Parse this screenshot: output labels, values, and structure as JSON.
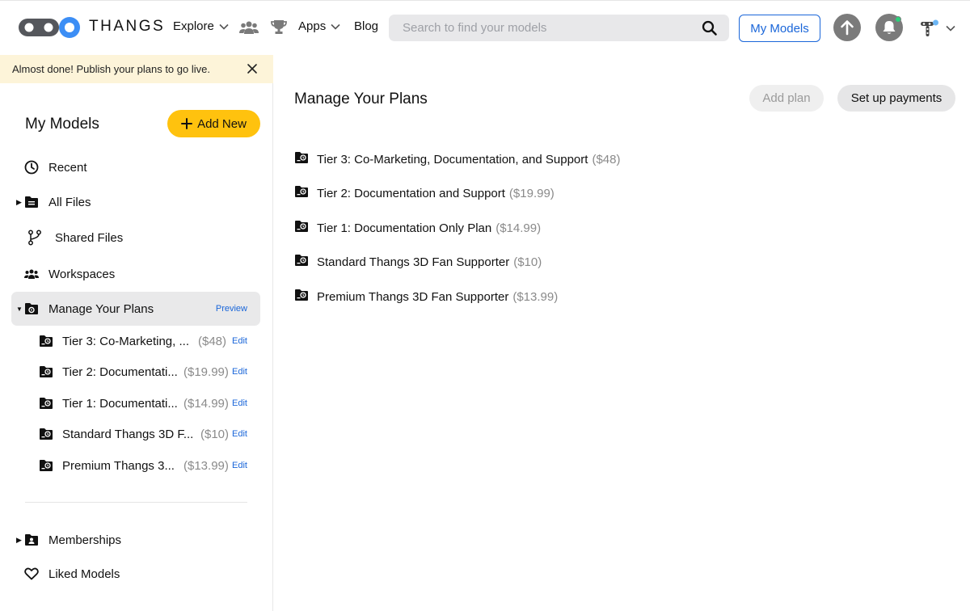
{
  "header": {
    "brand": "THANGS",
    "nav": [
      {
        "label": "Explore",
        "chevron": true
      },
      {
        "label": "Apps",
        "chevron": true
      },
      {
        "label": "Blog",
        "chevron": false
      }
    ],
    "search_placeholder": "Search to find your models",
    "my_models_label": "My Models"
  },
  "banner": {
    "text": "Almost done! Publish your plans to go live."
  },
  "sidebar": {
    "title": "My Models",
    "add_new_label": "Add New",
    "items": [
      {
        "label": "Recent",
        "icon": "clock-icon"
      },
      {
        "label": "All Files",
        "icon": "folder-icon"
      },
      {
        "label": "Shared Files",
        "icon": "branch-icon"
      },
      {
        "label": "Workspaces",
        "icon": "people-icon"
      },
      {
        "label": "Manage Your Plans",
        "icon": "folder-gear-icon",
        "badge": "Preview"
      }
    ],
    "plans": [
      {
        "name": "Tier 3: Co-Marketing, ...",
        "price": "($48)",
        "edit": "Edit"
      },
      {
        "name": "Tier 2: Documentati...",
        "price": "($19.99)",
        "edit": "Edit"
      },
      {
        "name": "Tier 1: Documentati...",
        "price": "($14.99)",
        "edit": "Edit"
      },
      {
        "name": "Standard Thangs 3D F...",
        "price": "($10)",
        "edit": "Edit"
      },
      {
        "name": "Premium Thangs 3...",
        "price": "($13.99)",
        "edit": "Edit"
      }
    ],
    "bottom_items": [
      {
        "label": "Memberships",
        "icon": "folder-person-icon"
      },
      {
        "label": "Liked Models",
        "icon": "heart-icon"
      }
    ]
  },
  "main": {
    "title": "Manage Your Plans",
    "add_plan_label": "Add plan",
    "setup_payments_label": "Set up payments",
    "plans": [
      {
        "name": "Tier 3: Co-Marketing, Documentation, and Support",
        "price": "($48)"
      },
      {
        "name": "Tier 2: Documentation and Support",
        "price": "($19.99)"
      },
      {
        "name": "Tier 1: Documentation Only Plan",
        "price": "($14.99)"
      },
      {
        "name": "Standard Thangs 3D Fan Supporter",
        "price": "($10)"
      },
      {
        "name": "Premium Thangs 3D Fan Supporter",
        "price": "($13.99)"
      }
    ]
  },
  "colors": {
    "accent_blue": "#1a66d9",
    "add_yellow": "#ffc20e",
    "banner_bg": "#fdf4d9",
    "status_green": "#2bd07a"
  }
}
